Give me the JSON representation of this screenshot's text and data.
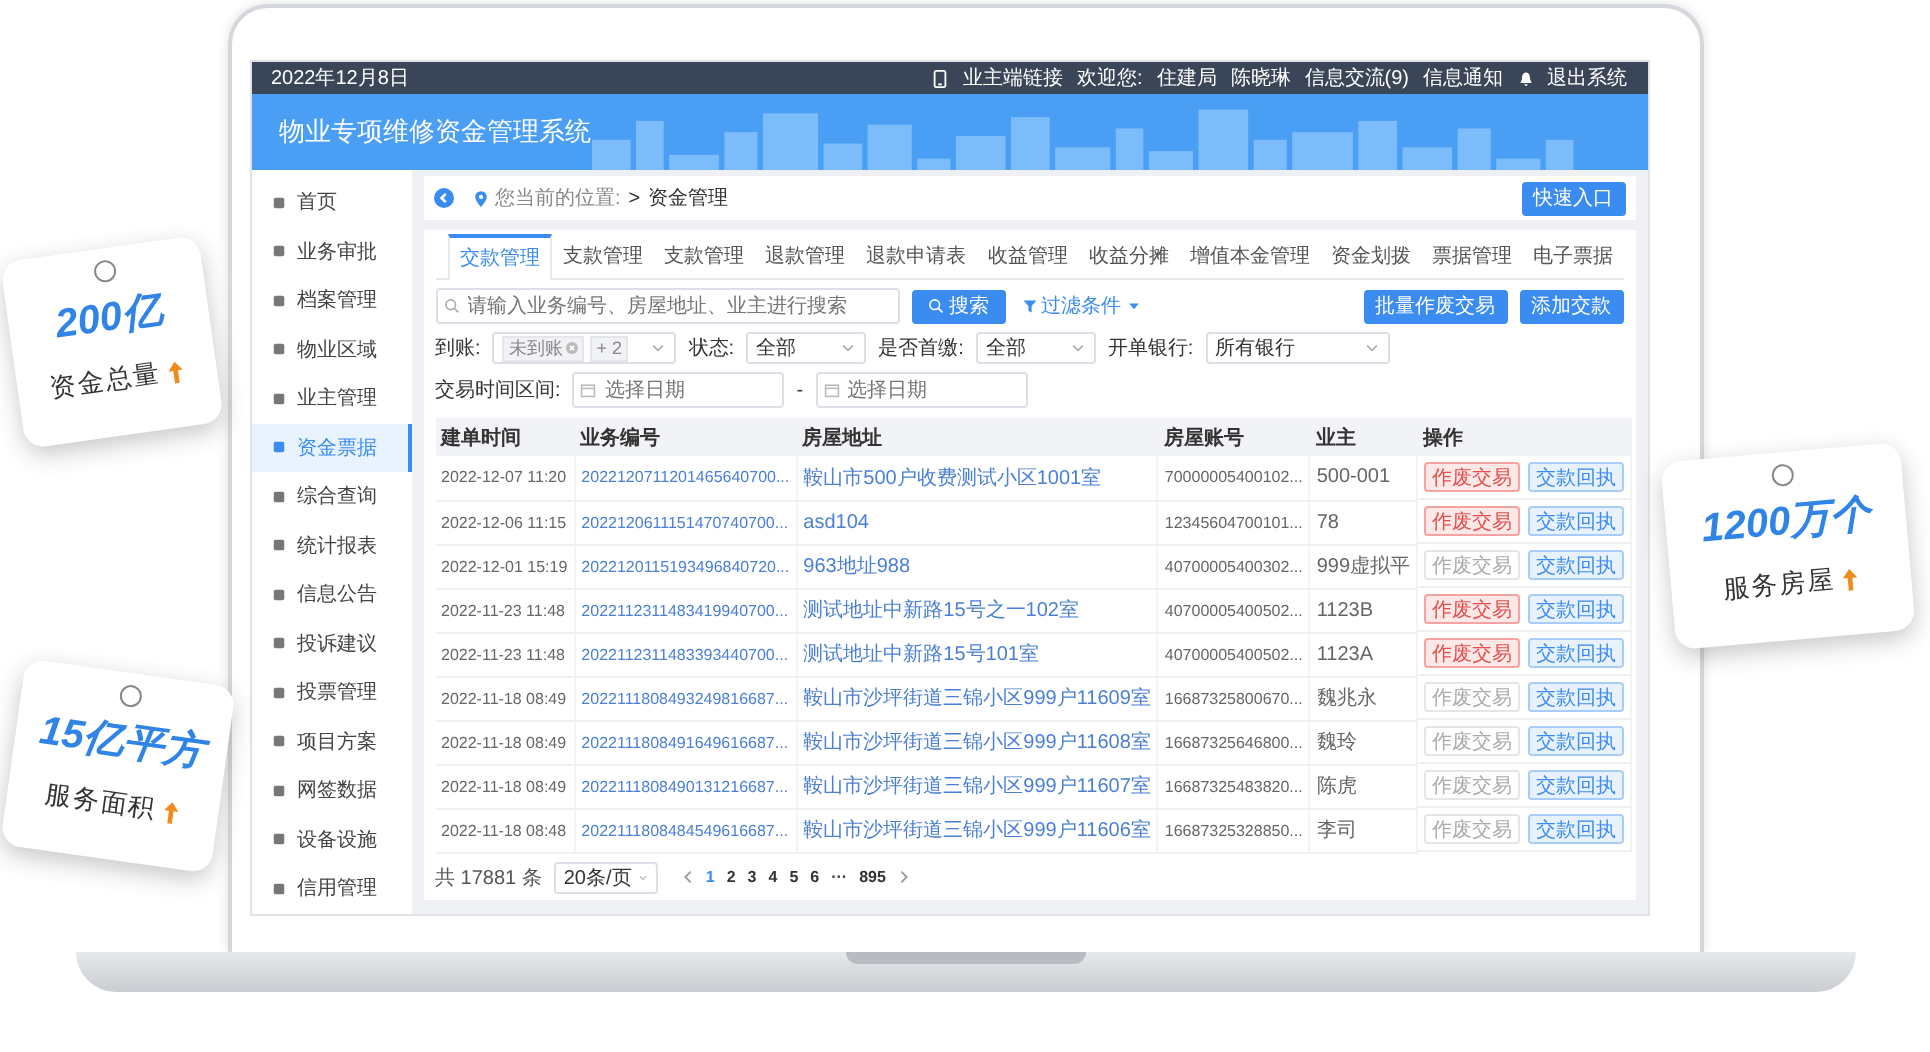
{
  "topbar": {
    "date": "2022年12月8日",
    "owner_link": "业主端链接",
    "welcome": "欢迎您:",
    "department": "住建局",
    "user": "陈晓琳",
    "messages": "信息交流(9)",
    "notices": "信息通知",
    "logout": "退出系统"
  },
  "header": {
    "title": "物业专项维修资金管理系统"
  },
  "sidebar": {
    "items": [
      {
        "label": "首页",
        "selected": false
      },
      {
        "label": "业务审批",
        "selected": false
      },
      {
        "label": "档案管理",
        "selected": false
      },
      {
        "label": "物业区域",
        "selected": false
      },
      {
        "label": "业主管理",
        "selected": false
      },
      {
        "label": "资金票据",
        "selected": true
      },
      {
        "label": "综合查询",
        "selected": false
      },
      {
        "label": "统计报表",
        "selected": false
      },
      {
        "label": "信息公告",
        "selected": false
      },
      {
        "label": "投诉建议",
        "selected": false
      },
      {
        "label": "投票管理",
        "selected": false
      },
      {
        "label": "项目方案",
        "selected": false
      },
      {
        "label": "网签数据",
        "selected": false
      },
      {
        "label": "设备设施",
        "selected": false
      },
      {
        "label": "信用管理",
        "selected": false
      }
    ]
  },
  "breadcrumb": {
    "prefix": "您当前的位置:",
    "separator": ">",
    "current": "资金管理"
  },
  "quick_entry": "快速入口",
  "tabs": [
    {
      "label": "交款管理",
      "selected": true
    },
    {
      "label": "支款管理",
      "selected": false
    },
    {
      "label": "支款管理",
      "selected": false
    },
    {
      "label": "退款管理",
      "selected": false
    },
    {
      "label": "退款申请表",
      "selected": false
    },
    {
      "label": "收益管理",
      "selected": false
    },
    {
      "label": "收益分摊",
      "selected": false
    },
    {
      "label": "增值本金管理",
      "selected": false
    },
    {
      "label": "资金划拨",
      "selected": false
    },
    {
      "label": "票据管理",
      "selected": false
    },
    {
      "label": "电子票据",
      "selected": false
    }
  ],
  "search": {
    "placeholder": "请输入业务编号、房屋地址、业主进行搜索",
    "button": "搜索",
    "filter": "过滤条件"
  },
  "actions": [
    "批量作废交易",
    "添加交款"
  ],
  "filters": [
    {
      "label": "到账:",
      "kind": "tags",
      "tags": [
        "未到账"
      ],
      "more": "+ 2"
    },
    {
      "label": "状态:",
      "kind": "select",
      "value": "全部"
    },
    {
      "label": "是否首缴:",
      "kind": "select",
      "value": "全部"
    },
    {
      "label": "开单银行:",
      "kind": "select",
      "value": "所有银行"
    }
  ],
  "date_range": {
    "label": "交易时间区间:",
    "start_placeholder": "选择日期",
    "separator": "-",
    "end_placeholder": "选择日期"
  },
  "table": {
    "columns": [
      "建单时间",
      "业务编号",
      "房屋地址",
      "房屋账号",
      "业主",
      "操作"
    ],
    "rows": [
      {
        "time": "2022-12-07 11:20",
        "number": "2022120711201465640700...",
        "address": "鞍山市500户收费测试小区1001室",
        "account": "70000005400102...",
        "owner": "500-001",
        "void_label": "作废交易",
        "void_disabled": false,
        "receipt_label": "交款回执"
      },
      {
        "time": "2022-12-06 11:15",
        "number": "2022120611151470740700...",
        "address": "asd104",
        "account": "12345604700101...",
        "owner": "78",
        "void_label": "作废交易",
        "void_disabled": false,
        "receipt_label": "交款回执"
      },
      {
        "time": "2022-12-01 15:19",
        "number": "2022120115193496840720...",
        "address": "963地址988",
        "account": "40700005400302...",
        "owner": "999虚拟平",
        "void_label": "作废交易",
        "void_disabled": true,
        "receipt_label": "交款回执"
      },
      {
        "time": "2022-11-23 11:48",
        "number": "2022112311483419940700...",
        "address": "测试地址中新路15号之一102室",
        "account": "40700005400502...",
        "owner": "1123B",
        "void_label": "作废交易",
        "void_disabled": false,
        "receipt_label": "交款回执"
      },
      {
        "time": "2022-11-23 11:48",
        "number": "2022112311483393440700...",
        "address": "测试地址中新路15号101室",
        "account": "40700005400502...",
        "owner": "1123A",
        "void_label": "作废交易",
        "void_disabled": false,
        "receipt_label": "交款回执"
      },
      {
        "time": "2022-11-18 08:49",
        "number": "2022111808493249816687...",
        "address": "鞍山市沙坪街道三锦小区999户11609室",
        "account": "16687325800670...",
        "owner": "魏兆永",
        "void_label": "作废交易",
        "void_disabled": true,
        "receipt_label": "交款回执"
      },
      {
        "time": "2022-11-18 08:49",
        "number": "2022111808491649616687...",
        "address": "鞍山市沙坪街道三锦小区999户11608室",
        "account": "16687325646800...",
        "owner": "魏玲",
        "void_label": "作废交易",
        "void_disabled": true,
        "receipt_label": "交款回执"
      },
      {
        "time": "2022-11-18 08:49",
        "number": "2022111808490131216687...",
        "address": "鞍山市沙坪街道三锦小区999户11607室",
        "account": "16687325483820...",
        "owner": "陈虎",
        "void_label": "作废交易",
        "void_disabled": true,
        "receipt_label": "交款回执"
      },
      {
        "time": "2022-11-18 08:48",
        "number": "2022111808484549616687...",
        "address": "鞍山市沙坪街道三锦小区999户11606室",
        "account": "16687325328850...",
        "owner": "李司",
        "void_label": "作废交易",
        "void_disabled": true,
        "receipt_label": "交款回执"
      }
    ]
  },
  "pagination": {
    "total": "共 17881 条",
    "page_size": "20条/页",
    "pages": [
      {
        "label": "1",
        "selected": true
      },
      {
        "label": "2",
        "selected": false
      },
      {
        "label": "3",
        "selected": false
      },
      {
        "label": "4",
        "selected": false
      },
      {
        "label": "5",
        "selected": false
      },
      {
        "label": "6",
        "selected": false
      },
      {
        "label": "···",
        "selected": false
      },
      {
        "label": "895",
        "selected": false
      }
    ]
  },
  "stats": [
    {
      "value": "200亿",
      "label": "资金总量"
    },
    {
      "value": "15亿平方",
      "label": "服务面积"
    },
    {
      "value": "1200万个",
      "label": "服务房屋"
    }
  ]
}
